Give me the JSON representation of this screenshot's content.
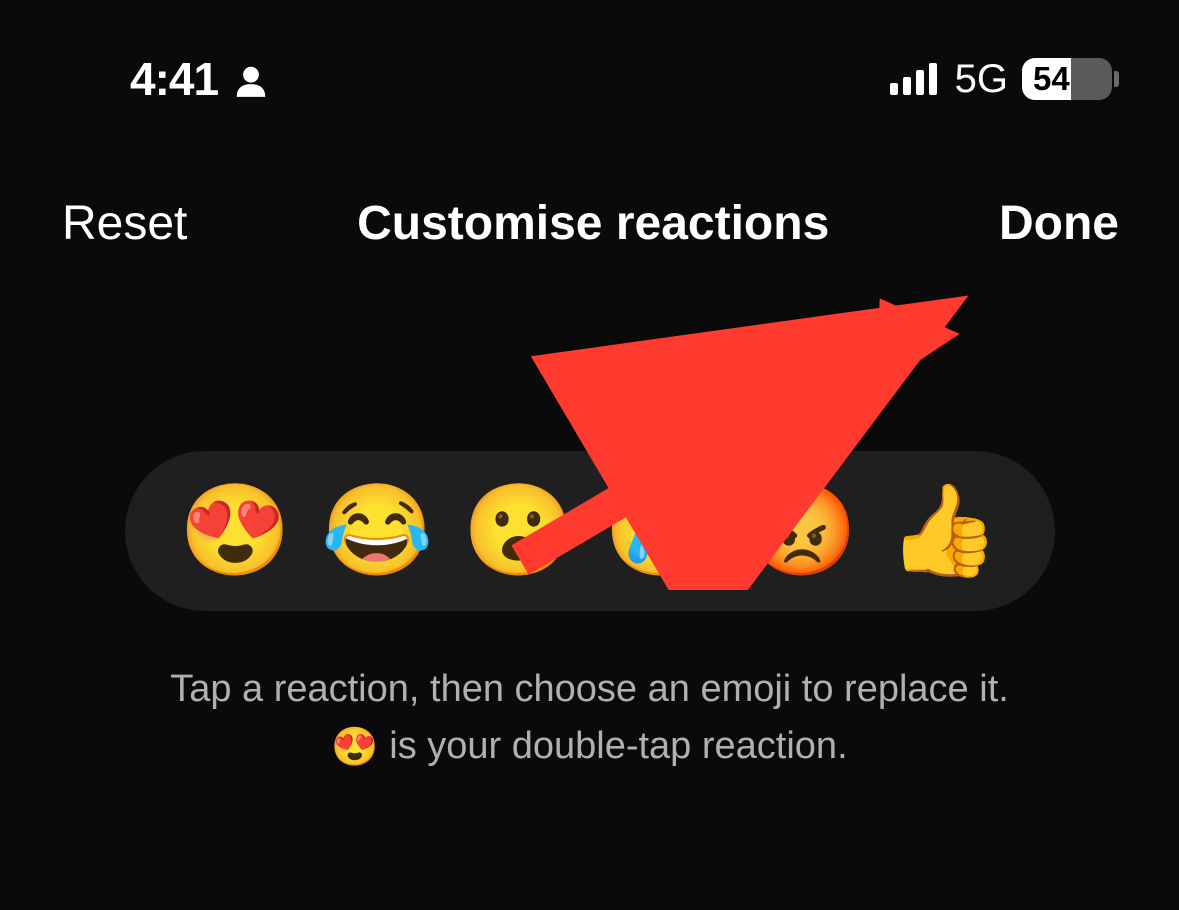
{
  "status": {
    "time": "4:41",
    "network": "5G",
    "battery": "54"
  },
  "nav": {
    "left": "Reset",
    "title": "Customise reactions",
    "right": "Done"
  },
  "reactions": {
    "slot1": "😍",
    "slot2": "😂",
    "slot3": "😮",
    "slot4": "😢",
    "slot5": "😡",
    "slot6": "👍"
  },
  "help": {
    "line1": "Tap a reaction, then choose an emoji to replace it.",
    "emoji": "😍",
    "line2_suffix": " is your double-tap reaction."
  }
}
